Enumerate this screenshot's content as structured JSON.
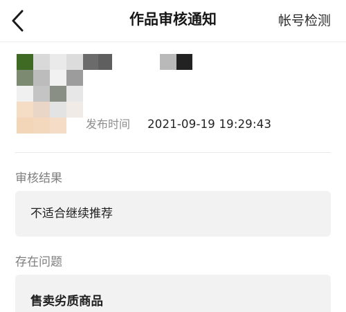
{
  "header": {
    "title": "作品审核通知",
    "right_action": "帐号检测"
  },
  "author": {
    "publish_label": "发布时间",
    "publish_time": "2021-09-19 19:29:43"
  },
  "review": {
    "result_title": "审核结果",
    "result_value": "不适合继续推荐",
    "issue_title": "存在问题",
    "issue_value": "售卖劣质商品"
  },
  "colors": {
    "card_background": "#f2f2f2",
    "muted_text": "#8c8c8c",
    "primary_text": "#1f1f1f"
  },
  "icons": {
    "back": "chevron-left-icon"
  }
}
